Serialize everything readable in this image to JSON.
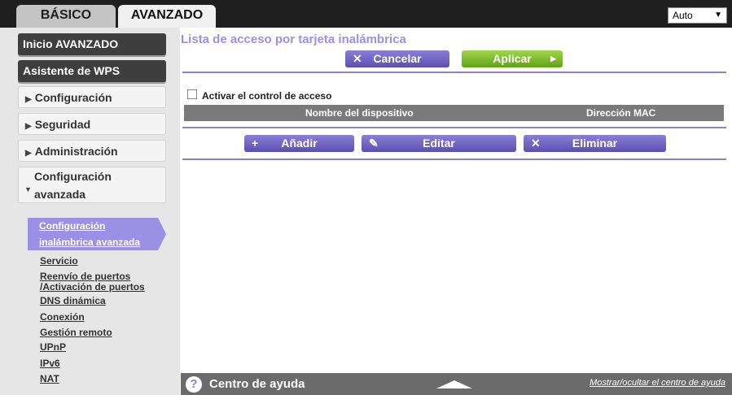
{
  "tabs": {
    "basic": "BÁSICO",
    "advanced": "AVANZADO"
  },
  "language": {
    "selected": "Auto"
  },
  "sidebar": {
    "home": "Inicio AVANZADO",
    "wps": "Asistente de WPS",
    "config": "Configuración",
    "security": "Seguridad",
    "admin": "Administración",
    "advanced_config": "Configuración avanzada",
    "active_subitem": "Configuración inalámbrica avanzada",
    "subitems": [
      "Servicio",
      "Reenvío de puertos",
      "/Activación de puertos",
      "DNS dinámica",
      "Conexión",
      "Gestión remoto",
      "UPnP",
      "IPv6",
      "NAT"
    ]
  },
  "main": {
    "title": "Lista de acceso por tarjeta inalámbrica",
    "cancel_label": "Cancelar",
    "apply_label": "Aplicar",
    "access_control_label": "Activar el control de acceso",
    "access_control_checked": false,
    "table": {
      "col_name": "Nombre del dispositivo",
      "col_mac": "Dirección MAC",
      "rows": []
    },
    "add_label": "Añadir",
    "edit_label": "Editar",
    "delete_label": "Eliminar"
  },
  "help": {
    "title": "Centro de ayuda",
    "toggle": "Mostrar/ocultar el centro de ayuda"
  },
  "colors": {
    "accent": "#9b8fe6",
    "apply_green": "#6cb21c",
    "button_purple": "#5a4fb0"
  }
}
